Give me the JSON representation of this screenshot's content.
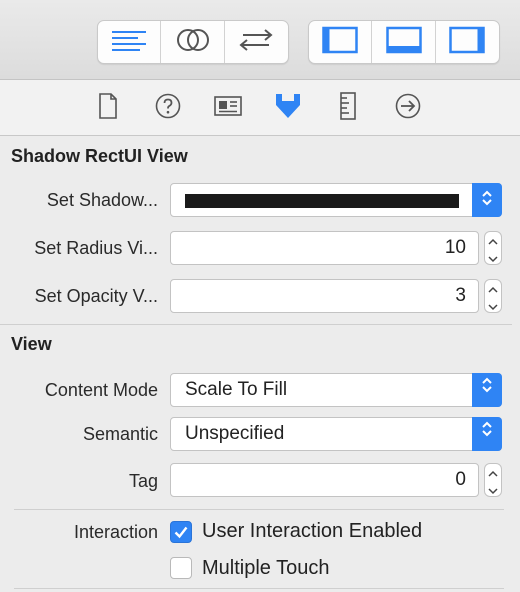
{
  "toolbar": {
    "editor_buttons": [
      {
        "icon": "standard-editor-icon"
      },
      {
        "icon": "assistant-editor-icon"
      },
      {
        "icon": "version-editor-icon"
      }
    ],
    "view_buttons": [
      {
        "icon": "navigator-toggle-icon"
      },
      {
        "icon": "debug-area-toggle-icon"
      },
      {
        "icon": "utilities-toggle-icon"
      }
    ]
  },
  "inspector_tabs": [
    {
      "icon": "file-inspector-icon",
      "selected": false
    },
    {
      "icon": "quick-help-icon",
      "selected": false
    },
    {
      "icon": "identity-inspector-icon",
      "selected": false
    },
    {
      "icon": "attributes-inspector-icon",
      "selected": true
    },
    {
      "icon": "size-inspector-icon",
      "selected": false
    },
    {
      "icon": "connections-inspector-icon",
      "selected": false
    }
  ],
  "shadow_section": {
    "title": "Shadow RectUI View",
    "shadow_color": {
      "label": "Set Shadow...",
      "value": "#1a1a1a"
    },
    "radius": {
      "label": "Set Radius Vi...",
      "value": "10"
    },
    "opacity": {
      "label": "Set Opacity V...",
      "value": "3"
    }
  },
  "view_section": {
    "title": "View",
    "content_mode": {
      "label": "Content Mode",
      "value": "Scale To Fill"
    },
    "semantic": {
      "label": "Semantic",
      "value": "Unspecified"
    },
    "tag": {
      "label": "Tag",
      "value": "0"
    },
    "interaction": {
      "label": "Interaction",
      "options": [
        {
          "label": "User Interaction Enabled",
          "checked": true
        },
        {
          "label": "Multiple Touch",
          "checked": false
        }
      ]
    }
  },
  "colors": {
    "accent": "#2f84f4",
    "icon_gray": "#555555"
  }
}
